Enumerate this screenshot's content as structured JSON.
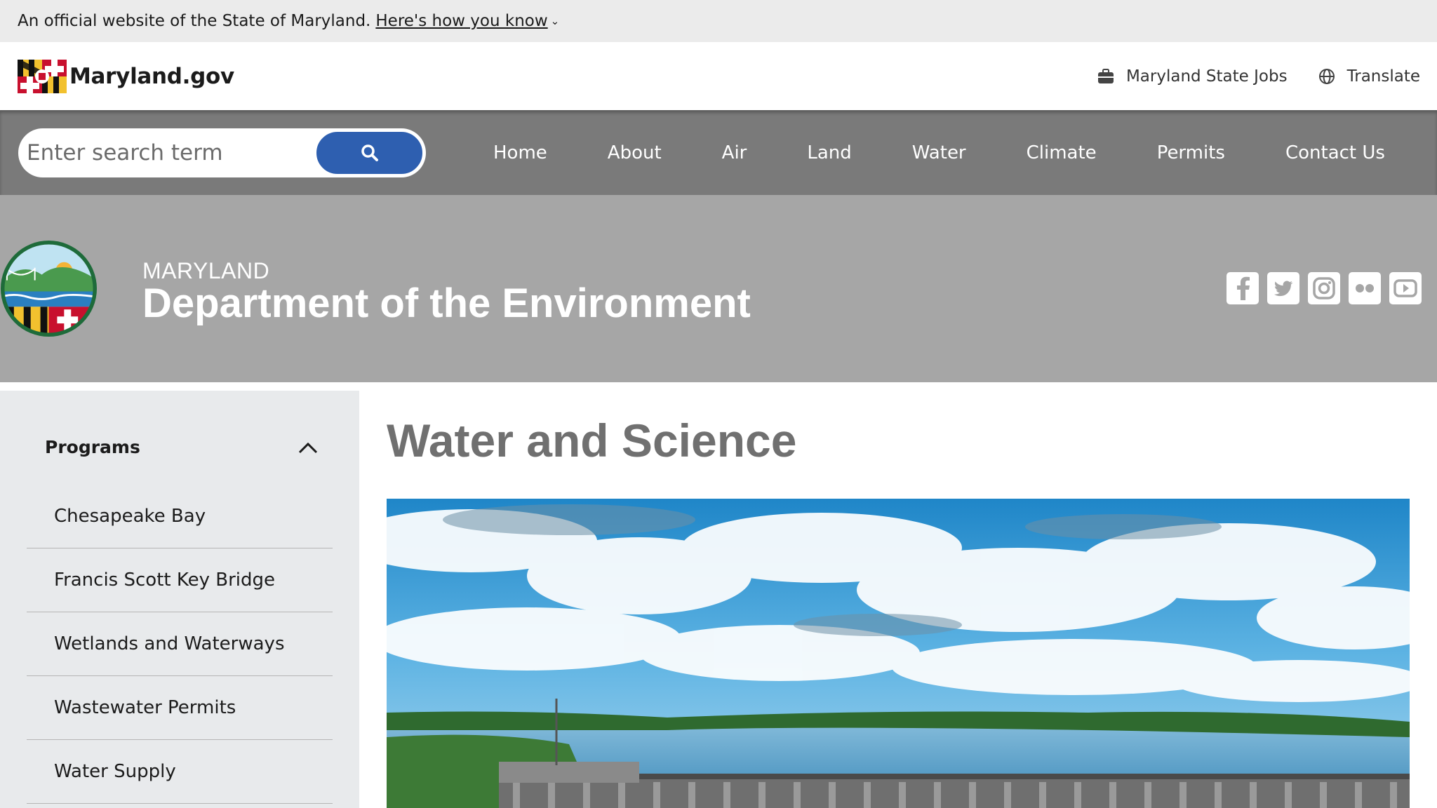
{
  "gov_banner": {
    "text": "An official website of the State of Maryland.",
    "link": "Here's how you know",
    "chevron": "⌄"
  },
  "header": {
    "logo_text": "Maryland.gov",
    "utility": [
      {
        "label": "Maryland State Jobs",
        "icon": "briefcase-icon"
      },
      {
        "label": "Translate",
        "icon": "globe-icon"
      }
    ]
  },
  "search": {
    "placeholder": "Enter search term",
    "value": ""
  },
  "nav": {
    "items": [
      "Home",
      "About",
      "Air",
      "Land",
      "Water",
      "Climate",
      "Permits",
      "Contact Us"
    ]
  },
  "agency": {
    "kicker": "MARYLAND",
    "title": "Department of the Environment",
    "social": [
      "facebook-icon",
      "twitter-icon",
      "instagram-icon",
      "flickr-icon",
      "youtube-icon"
    ]
  },
  "sidebar": {
    "heading": "Programs",
    "items": [
      "Chesapeake Bay",
      "Francis Scott Key Bridge",
      "Wetlands and Waterways",
      "Wastewater Permits",
      "Water Supply"
    ]
  },
  "main": {
    "title": "Water and Science"
  },
  "colors": {
    "nav_bg": "#7a7a7a",
    "agency_bg": "#a6a6a6",
    "search_button": "#2e5fb0",
    "sidebar_bg": "#e8eaec"
  }
}
